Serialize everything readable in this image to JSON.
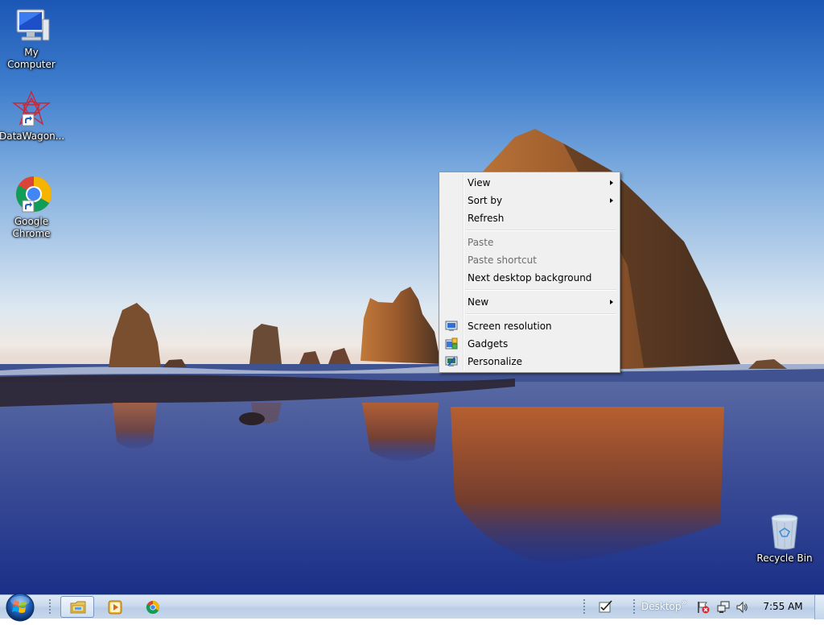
{
  "desktop": {
    "icons": [
      {
        "label": "My Computer",
        "icon": "my-computer-icon"
      },
      {
        "label": "DataWagon...",
        "icon": "datawagon-icon",
        "shortcut": true
      },
      {
        "label": "Google\nChrome",
        "icon": "chrome-icon",
        "shortcut": true
      },
      {
        "label": "Recycle Bin",
        "icon": "recycle-bin-icon"
      }
    ]
  },
  "context_menu": {
    "view": "View",
    "sort_by": "Sort by",
    "refresh": "Refresh",
    "paste": "Paste",
    "paste_shortcut": "Paste shortcut",
    "next_background": "Next desktop background",
    "new": "New",
    "screen_resolution": "Screen resolution",
    "gadgets": "Gadgets",
    "personalize": "Personalize"
  },
  "taskbar": {
    "desktop_toolbar": "Desktop",
    "chevron": "»",
    "clock": "7:55 AM",
    "pinned": [
      "windows-explorer-icon",
      "media-player-icon",
      "chrome-icon"
    ],
    "tray_icons": [
      "action-center-icon",
      "network-icon",
      "volume-icon"
    ]
  },
  "colors": {
    "menu_bg": "#f0f0f0",
    "menu_border": "#979797",
    "taskbar": "#c9d9ec"
  }
}
